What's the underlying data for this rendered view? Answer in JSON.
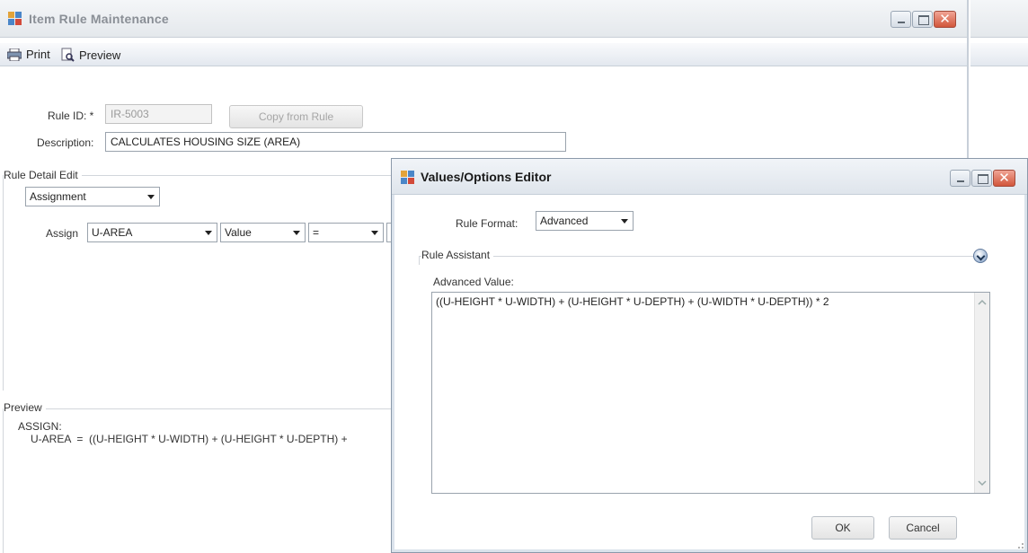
{
  "main_window": {
    "title": "Item Rule Maintenance",
    "toolbar": {
      "print_label": "Print",
      "preview_label": "Preview"
    },
    "rule_id_label": "Rule ID: *",
    "rule_id_value": "IR-5003",
    "copy_button_label": "Copy from Rule",
    "description_label": "Description:",
    "description_value": "CALCULATES HOUSING SIZE (AREA)",
    "rule_detail": {
      "group_title": "Rule Detail Edit",
      "type_value": "Assignment",
      "assign_label": "Assign",
      "target_value": "U-AREA",
      "source_value": "Value",
      "operator_value": "="
    },
    "preview": {
      "group_title": "Preview",
      "line1": "ASSIGN:",
      "line2": "U-AREA  =  ((U-HEIGHT * U-WIDTH) + (U-HEIGHT * U-DEPTH) +"
    }
  },
  "dialog": {
    "title": "Values/Options Editor",
    "rule_format_label": "Rule Format:",
    "rule_format_value": "Advanced",
    "rule_assistant_label": "Rule Assistant",
    "advanced_value_label": "Advanced Value:",
    "advanced_value": "((U-HEIGHT * U-WIDTH) + (U-HEIGHT * U-DEPTH) + (U-WIDTH * U-DEPTH)) * 2",
    "ok_label": "OK",
    "cancel_label": "Cancel"
  },
  "icons": {
    "app": "app-window-icon",
    "print": "printer-icon",
    "preview": "preview-icon",
    "expander": "chevron-down-circle-icon"
  },
  "colors": {
    "close_button": "#d2563b",
    "group_line": "#d2d6db",
    "title_inactive": "#8a8f96"
  }
}
